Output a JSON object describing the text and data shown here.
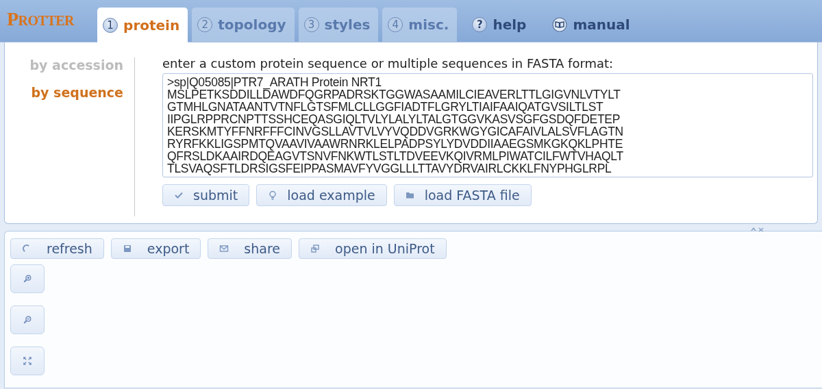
{
  "logo": "Protter",
  "tabs": [
    {
      "kind": "step",
      "badge": "1",
      "label": "protein",
      "selected": true,
      "disabled": false
    },
    {
      "kind": "step",
      "badge": "2",
      "label": "topology",
      "selected": false,
      "disabled": true
    },
    {
      "kind": "step",
      "badge": "3",
      "label": "styles",
      "selected": false,
      "disabled": true
    },
    {
      "kind": "step",
      "badge": "4",
      "label": "misc.",
      "selected": false,
      "disabled": true
    },
    {
      "kind": "help",
      "badge": "?",
      "label": "help"
    },
    {
      "kind": "book",
      "label": "manual"
    }
  ],
  "sidebar": {
    "items": [
      {
        "label": "by accession",
        "selected": false
      },
      {
        "label": "by sequence",
        "selected": true
      }
    ]
  },
  "prompt": "enter a custom protein sequence or multiple sequences in FASTA format:",
  "sequence": [
    ">sp|Q05085|PTR7_ARATH Protein NRT1",
    "MSLPETKSDDILLDAWDFQGRPADRSKTGGWASAAMILCIEAVERLTTLGIGVNLVTYLT",
    "GTMHLGNATAANTVTNFLGTSFMLCLLGGFIADTFLGRYLTIAIFAAIQATGVSILTLST",
    "IIPGLRPPRCNPTTSSHCEQASGIQLTVLYLALYLTALGTGGVKASVSGFGSDQFDETEP",
    "KERSKMTYFFNRFFFCINVGSLLAVTVLVYVQDDVGRKWGYGICAFAIVLALSVFLAGTN",
    "RYRFKKLIGSPMTQVAAVIVAAWRNRKLELPADPSYLYDVDDIIAAEGSMKGKQKLPHTE",
    "QFRSLDKAAIRDQEAGVTSNVFNKWTLSTLTDVEEVKQIVRMLPIWATCILFWTVHAQLT",
    "TLSVAQSFTLDRSIGSFEIPPASMAVFYVGGLLLTTAVYDRVAIRLCKKLFNYPHGLRPL"
  ],
  "form_buttons": [
    {
      "kind": "check",
      "label": "submit"
    },
    {
      "kind": "bulb",
      "label": "load example"
    },
    {
      "kind": "folder",
      "label": "load FASTA file"
    }
  ],
  "tool_buttons": [
    {
      "kind": "refresh",
      "label": "refresh"
    },
    {
      "kind": "disk",
      "label": "export"
    },
    {
      "kind": "mail",
      "label": "share"
    },
    {
      "kind": "window",
      "label": "open in UniProt"
    }
  ],
  "zoom_buttons": [
    {
      "kind": "zoom-in"
    },
    {
      "kind": "zoom-out"
    },
    {
      "kind": "fit"
    }
  ]
}
